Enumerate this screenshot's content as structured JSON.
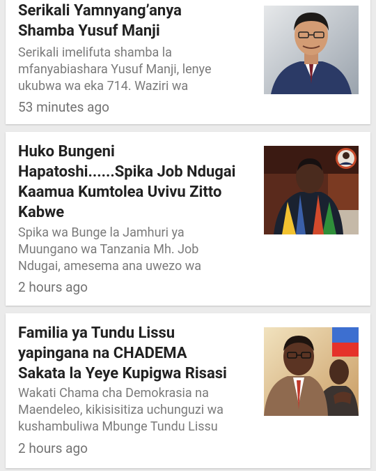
{
  "articles": [
    {
      "headline": "Serikali Yamnyang’anya\nShamba  Yusuf  Manji",
      "snippet": "Serikali imelifuta shamba la\nmfanyabiashara Yusuf Manji, lenye\nukubwa wa eka 714. Waziri wa",
      "time": "53 minutes ago",
      "thumbnail": "portrait-man-suit-icon"
    },
    {
      "headline": "Huko Bungeni\nHapatoshi......Spika Job Ndugai\nKaamua Kumtolea Uvivu Zitto\nKabwe",
      "snippet": "Spika wa Bunge la Jamhuri ya\nMuungano wa Tanzania Mh. Job\nNdugai, amesema ana uwezo wa",
      "time": "2 hours ago",
      "thumbnail": "parliament-speaker-icon"
    },
    {
      "headline": " Familia ya Tundu Lissu\nyapingana na CHADEMA\nSakata  la Yeye Kupigwa Risasi",
      "snippet": "Wakati Chama cha Demokrasia na\nMaendeleo, kikisisitiza uchunguzi wa\nkushambuliwa Mbunge Tundu Lissu",
      "time": "2 hours ago",
      "thumbnail": "politician-flag-icon"
    }
  ]
}
